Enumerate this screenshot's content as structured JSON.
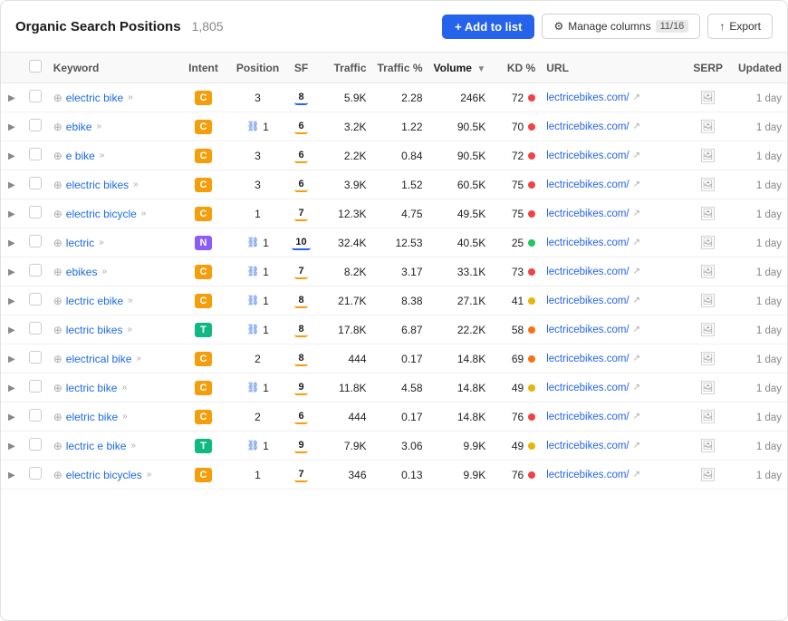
{
  "header": {
    "title": "Organic Search Positions",
    "count": "1,805",
    "add_label": "+ Add to list",
    "manage_label": "Manage columns",
    "manage_count": "11/16",
    "export_label": "Export"
  },
  "table": {
    "columns": [
      {
        "id": "expand",
        "label": ""
      },
      {
        "id": "check",
        "label": ""
      },
      {
        "id": "keyword",
        "label": "Keyword"
      },
      {
        "id": "intent",
        "label": "Intent"
      },
      {
        "id": "position",
        "label": "Position"
      },
      {
        "id": "sf",
        "label": "SF"
      },
      {
        "id": "traffic",
        "label": "Traffic"
      },
      {
        "id": "traffic_pct",
        "label": "Traffic %"
      },
      {
        "id": "volume",
        "label": "Volume",
        "sorted": true
      },
      {
        "id": "kd_pct",
        "label": "KD %"
      },
      {
        "id": "url",
        "label": "URL"
      },
      {
        "id": "serp",
        "label": "SERP"
      },
      {
        "id": "updated",
        "label": "Updated"
      }
    ],
    "rows": [
      {
        "keyword": "electric bike",
        "intent": "C",
        "intent_class": "intent-c",
        "position": "3",
        "has_link": false,
        "sf": "8",
        "sf_style": "sf-underlined-blue",
        "traffic": "5.9K",
        "traffic_pct": "2.28",
        "volume": "246K",
        "kd": "72",
        "kd_dot": "dot-red",
        "url": "lectricebikes.com/",
        "updated": "1 day"
      },
      {
        "keyword": "ebike",
        "intent": "C",
        "intent_class": "intent-c",
        "position": "1",
        "has_link": true,
        "sf": "6",
        "sf_style": "",
        "traffic": "3.2K",
        "traffic_pct": "1.22",
        "volume": "90.5K",
        "kd": "70",
        "kd_dot": "dot-red",
        "url": "lectricebikes.com/",
        "updated": "1 day"
      },
      {
        "keyword": "e bike",
        "intent": "C",
        "intent_class": "intent-c",
        "position": "3",
        "has_link": false,
        "sf": "6",
        "sf_style": "",
        "traffic": "2.2K",
        "traffic_pct": "0.84",
        "volume": "90.5K",
        "kd": "72",
        "kd_dot": "dot-red",
        "url": "lectricebikes.com/",
        "updated": "1 day"
      },
      {
        "keyword": "electric bikes",
        "intent": "C",
        "intent_class": "intent-c",
        "position": "3",
        "has_link": false,
        "sf": "6",
        "sf_style": "",
        "traffic": "3.9K",
        "traffic_pct": "1.52",
        "volume": "60.5K",
        "kd": "75",
        "kd_dot": "dot-red",
        "url": "lectricebikes.com/",
        "updated": "1 day"
      },
      {
        "keyword": "electric bicycle",
        "intent": "C",
        "intent_class": "intent-c",
        "position": "1",
        "has_link": false,
        "sf": "7",
        "sf_style": "",
        "traffic": "12.3K",
        "traffic_pct": "4.75",
        "volume": "49.5K",
        "kd": "75",
        "kd_dot": "dot-red",
        "url": "lectricebikes.com/",
        "updated": "1 day"
      },
      {
        "keyword": "lectric",
        "intent": "N",
        "intent_class": "intent-n",
        "position": "1",
        "has_link": true,
        "sf": "10",
        "sf_style": "sf-underlined-blue",
        "traffic": "32.4K",
        "traffic_pct": "12.53",
        "volume": "40.5K",
        "kd": "25",
        "kd_dot": "dot-green",
        "url": "lectricebikes.com/",
        "updated": "1 day"
      },
      {
        "keyword": "ebikes",
        "intent": "C",
        "intent_class": "intent-c",
        "position": "1",
        "has_link": true,
        "sf": "7",
        "sf_style": "",
        "traffic": "8.2K",
        "traffic_pct": "3.17",
        "volume": "33.1K",
        "kd": "73",
        "kd_dot": "dot-red",
        "url": "lectricebikes.com/",
        "updated": "1 day"
      },
      {
        "keyword": "lectric ebike",
        "intent": "C",
        "intent_class": "intent-c",
        "position": "1",
        "has_link": true,
        "sf": "8",
        "sf_style": "",
        "traffic": "21.7K",
        "traffic_pct": "8.38",
        "volume": "27.1K",
        "kd": "41",
        "kd_dot": "dot-yellow",
        "url": "lectricebikes.com/",
        "updated": "1 day"
      },
      {
        "keyword": "lectric bikes",
        "intent": "T",
        "intent_class": "intent-t",
        "position": "1",
        "has_link": true,
        "sf": "8",
        "sf_style": "",
        "traffic": "17.8K",
        "traffic_pct": "6.87",
        "volume": "22.2K",
        "kd": "58",
        "kd_dot": "dot-orange",
        "url": "lectricebikes.com/",
        "updated": "1 day"
      },
      {
        "keyword": "electrical bike",
        "intent": "C",
        "intent_class": "intent-c",
        "position": "2",
        "has_link": false,
        "sf": "8",
        "sf_style": "",
        "traffic": "444",
        "traffic_pct": "0.17",
        "volume": "14.8K",
        "kd": "69",
        "kd_dot": "dot-orange",
        "url": "lectricebikes.com/",
        "updated": "1 day"
      },
      {
        "keyword": "lectric bike",
        "intent": "C",
        "intent_class": "intent-c",
        "position": "1",
        "has_link": true,
        "sf": "9",
        "sf_style": "",
        "traffic": "11.8K",
        "traffic_pct": "4.58",
        "volume": "14.8K",
        "kd": "49",
        "kd_dot": "dot-yellow",
        "url": "lectricebikes.com/",
        "updated": "1 day"
      },
      {
        "keyword": "eletric bike",
        "intent": "C",
        "intent_class": "intent-c",
        "position": "2",
        "has_link": false,
        "sf": "6",
        "sf_style": "",
        "traffic": "444",
        "traffic_pct": "0.17",
        "volume": "14.8K",
        "kd": "76",
        "kd_dot": "dot-red",
        "url": "lectricebikes.com/",
        "updated": "1 day"
      },
      {
        "keyword": "lectric e bike",
        "intent": "T",
        "intent_class": "intent-t",
        "position": "1",
        "has_link": true,
        "sf": "9",
        "sf_style": "",
        "traffic": "7.9K",
        "traffic_pct": "3.06",
        "volume": "9.9K",
        "kd": "49",
        "kd_dot": "dot-yellow",
        "url": "lectricebikes.com/",
        "updated": "1 day"
      },
      {
        "keyword": "electric bicycles",
        "intent": "C",
        "intent_class": "intent-c",
        "position": "1",
        "has_link": false,
        "sf": "7",
        "sf_style": "",
        "traffic": "346",
        "traffic_pct": "0.13",
        "volume": "9.9K",
        "kd": "76",
        "kd_dot": "dot-red",
        "url": "lectricebikes.com/",
        "updated": "1 day"
      }
    ]
  }
}
